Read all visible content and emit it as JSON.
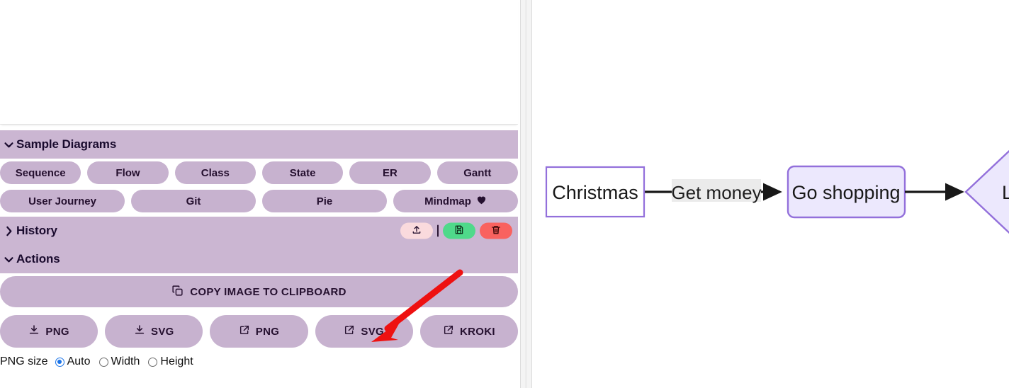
{
  "left_panel": {
    "editor": {
      "content": ""
    },
    "sections": [
      {
        "id": "sample-diagrams",
        "title": "Sample Diagrams",
        "chevron": "chevron-down-icon",
        "expanded": true,
        "rows": [
          [
            {
              "label": "Sequence"
            },
            {
              "label": "Flow"
            },
            {
              "label": "Class"
            },
            {
              "label": "State"
            },
            {
              "label": "ER"
            },
            {
              "label": "Gantt"
            }
          ],
          [
            {
              "label": "User Journey"
            },
            {
              "label": "Git"
            },
            {
              "label": "Pie"
            },
            {
              "label": "Mindmap",
              "icon": "heart-icon"
            }
          ]
        ]
      },
      {
        "id": "history",
        "title": "History",
        "chevron": "chevron-right-icon",
        "expanded": false,
        "actions": [
          {
            "id": "restore",
            "icon": "upload-icon",
            "color": "#fadadd"
          },
          {
            "id": "save",
            "icon": "floppy-disk-icon",
            "color": "#4fd98a"
          },
          {
            "id": "delete",
            "icon": "trash-icon",
            "color": "#f9625f"
          }
        ]
      },
      {
        "id": "actions",
        "title": "Actions",
        "chevron": "chevron-down-icon",
        "expanded": true
      }
    ]
  },
  "actions": {
    "copy_label": "COPY IMAGE TO CLIPBOARD",
    "copy_icon": "copy-icon",
    "exports": [
      {
        "label": "PNG",
        "icon": "download-icon"
      },
      {
        "label": "SVG",
        "icon": "download-icon"
      },
      {
        "label": "PNG",
        "icon": "external-link-icon"
      },
      {
        "label": "SVG",
        "icon": "external-link-icon"
      },
      {
        "label": "KROKI",
        "icon": "external-link-icon"
      }
    ],
    "png_size": {
      "label": "PNG size",
      "options": [
        {
          "label": "Auto",
          "selected": true
        },
        {
          "label": "Width",
          "selected": false
        },
        {
          "label": "Height",
          "selected": false
        }
      ]
    }
  },
  "diagram": {
    "nodes": [
      {
        "id": "n1",
        "label": "Christmas",
        "shape": "rect",
        "fill": "#ffffff",
        "stroke": "#9370db"
      },
      {
        "id": "n2",
        "label": "Go shopping",
        "shape": "rounded",
        "fill": "#ece8fd",
        "stroke": "#9370db"
      },
      {
        "id": "n3",
        "label": "Le",
        "shape": "diamond",
        "fill": "#ece8fd",
        "stroke": "#9370db"
      }
    ],
    "edges": [
      {
        "from": "n1",
        "to": "n2",
        "label": "Get money",
        "label_bg": "#ebebeb"
      },
      {
        "from": "n2",
        "to": "n3",
        "label": ""
      }
    ]
  },
  "annotation": {
    "type": "arrow",
    "color": "#ee1111",
    "points_to": "export-svg-button"
  },
  "colors": {
    "panel_header": "#cbb6d2",
    "pill": "#c7b2cf",
    "text_dark": "#25102f",
    "accent_radio": "#1a73e8",
    "node_stroke": "#9370db",
    "node_fill": "#ece8fd"
  }
}
